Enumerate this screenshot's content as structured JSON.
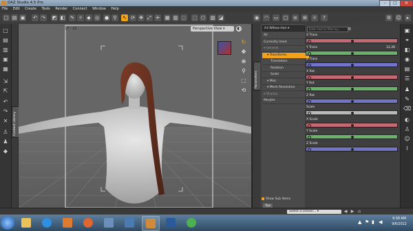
{
  "window": {
    "title": "DAZ Studio 4.5 Pro",
    "buttons": {
      "min": "–",
      "max": "□",
      "close": "✕"
    }
  },
  "menu": [
    "File",
    "Edit",
    "Create",
    "Tools",
    "Render",
    "Connect",
    "Window",
    "Help"
  ],
  "viewport": {
    "corner_label": "17 : 22",
    "camera": "Perspective View"
  },
  "left_tab": "Content Library",
  "right_tab": "Parameters",
  "panel": {
    "node_select": "A3 Willow Hair",
    "search_placeholder": "Enter text to filter by...",
    "tree": [
      {
        "label": "All",
        "indent": 0,
        "state": "normal"
      },
      {
        "label": "Currently Used",
        "indent": 0,
        "state": "normal"
      },
      {
        "label": "General",
        "indent": 0,
        "state": "dim"
      },
      {
        "label": "Transforms",
        "indent": 1,
        "state": "selected"
      },
      {
        "label": "Translation",
        "indent": 2,
        "state": "normal"
      },
      {
        "label": "Rotation",
        "indent": 2,
        "state": "normal"
      },
      {
        "label": "Scale",
        "indent": 2,
        "state": "normal"
      },
      {
        "label": "Misc",
        "indent": 1,
        "state": "normal"
      },
      {
        "label": "Mesh Resolution",
        "indent": 1,
        "state": "normal"
      },
      {
        "label": "Display",
        "indent": 0,
        "state": "dim"
      },
      {
        "label": "Morphs",
        "indent": 0,
        "state": "normal"
      }
    ],
    "parameters": [
      {
        "label": "X Trans",
        "value": "",
        "color": "#c56a73",
        "level": 0.5
      },
      {
        "label": "Y Trans",
        "value": "12.26",
        "color": "#6ab26a",
        "level": 0.5
      },
      {
        "label": "Z Trans",
        "value": "",
        "color": "#7275c7",
        "level": 0.5
      },
      {
        "label": "X Rot",
        "value": "",
        "color": "#c56a73",
        "level": 0.5
      },
      {
        "label": "Y Rot",
        "value": "",
        "color": "#6ab26a",
        "level": 0.5
      },
      {
        "label": "Z Rot",
        "value": "",
        "color": "#7275c7",
        "level": 0.5
      },
      {
        "label": "Scale",
        "value": "",
        "color": "#b8b8b8",
        "level": 0.5
      },
      {
        "label": "X Scale",
        "value": "",
        "color": "#c56a73",
        "level": 0.5
      },
      {
        "label": "Y Scale",
        "value": "",
        "color": "#6ab26a",
        "level": 0.5
      },
      {
        "label": "Z Scale",
        "value": "",
        "color": "#7275c7",
        "level": 0.5
      }
    ],
    "show_sub_items": "Show Sub Items",
    "bottom_tab": "Tips"
  },
  "lesson": {
    "placeholder": "Select a Lesson..."
  },
  "taskbar": {
    "apps": [
      {
        "name": "library",
        "color": "#e9c35a"
      },
      {
        "name": "internet-explorer",
        "color": "#2f8fe0"
      },
      {
        "name": "media-player",
        "color": "#e07a2f"
      },
      {
        "name": "firefox",
        "color": "#e0662f"
      },
      {
        "name": "reader",
        "color": "#6a8fb8"
      },
      {
        "name": "task-manager",
        "color": "#4a7ab0"
      },
      {
        "name": "daz-studio",
        "color": "#d08a3a"
      },
      {
        "name": "photoshop",
        "color": "#2a5a9a"
      },
      {
        "name": "chrome",
        "color": "#4caf50"
      }
    ],
    "time": "9:38 AM",
    "date": "9/6/2012"
  }
}
